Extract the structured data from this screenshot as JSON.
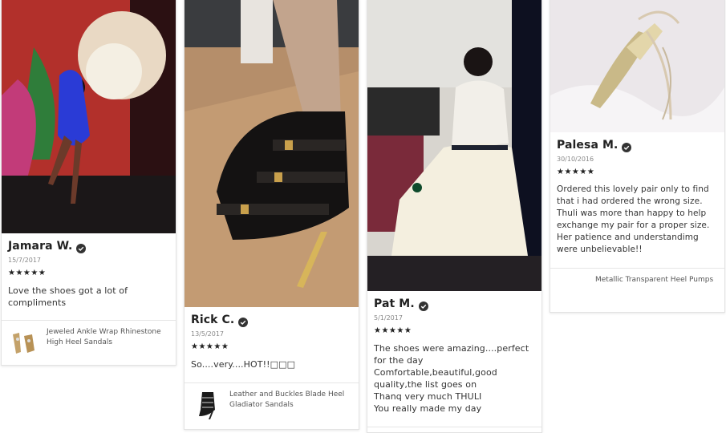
{
  "reviews": [
    {
      "name": "Jamara W.",
      "date": "15/7/2017",
      "stars": "★★★★★",
      "text": "Love the shoes got a lot of compliments",
      "product": "Jeweled Ankle Wrap Rhinestone High Heel Sandals"
    },
    {
      "name": "Rick C.",
      "date": "13/5/2017",
      "stars": "★★★★★",
      "text": "So....very....HOT!!□□□",
      "product": "Leather and Buckles Blade Heel Gladiator Sandals"
    },
    {
      "name": "Pat M.",
      "date": "5/1/2017",
      "stars": "★★★★★",
      "text": "The shoes were amazing....perfect for the day\nComfortable,beautiful,good quality,the list goes on\nThanq very much THULI\nYou really made my day",
      "product": ""
    },
    {
      "name": "Palesa M.",
      "date": "30/10/2016",
      "stars": "★★★★★",
      "text": "Ordered this lovely pair only to find that i had ordered the wrong size. Thuli was more than happy to help exchange my pair for a proper size. Her patience and understandimg were unbelievable!!",
      "product": "Metallic Transparent Heel Pumps"
    }
  ],
  "icons": {
    "verified": "verified-check-icon",
    "star": "star-icon"
  },
  "colors": {
    "star": "#222222",
    "verified": "#333333"
  }
}
